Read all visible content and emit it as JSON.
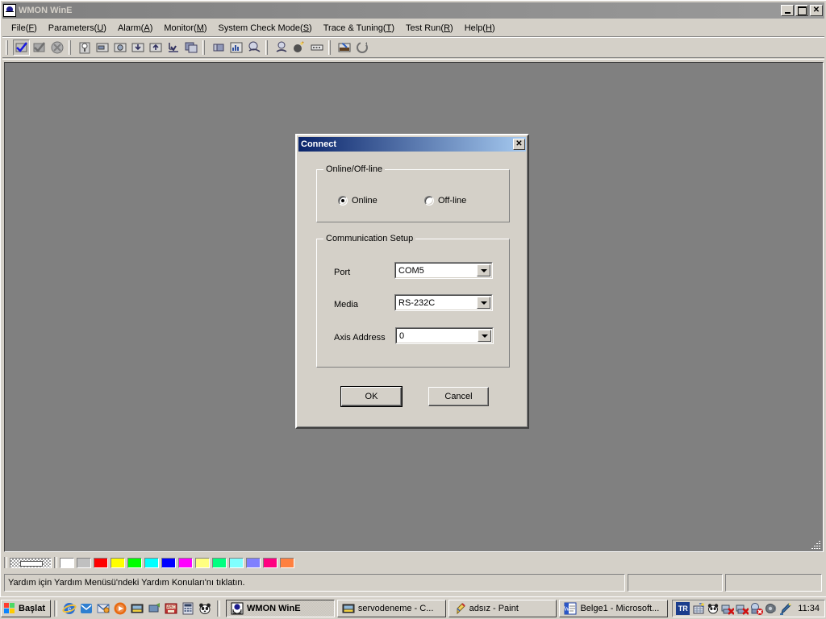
{
  "window": {
    "title": "WMON WinE",
    "icon": "app-icon",
    "controls": {
      "minimize": "_",
      "maximize": "□",
      "close": "✕"
    }
  },
  "menubar": {
    "items": [
      {
        "label": "File(F)",
        "text": "File(",
        "accel": "F",
        "tail": ")"
      },
      {
        "label": "Parameters(U)",
        "text": "Parameters(",
        "accel": "U",
        "tail": ")"
      },
      {
        "label": "Alarm(A)",
        "text": "Alarm(",
        "accel": "A",
        "tail": ")"
      },
      {
        "label": "Monitor(M)",
        "text": "Monitor(",
        "accel": "M",
        "tail": ")"
      },
      {
        "label": "System Check Mode(S)",
        "text": "System Check Mode(",
        "accel": "S",
        "tail": ")"
      },
      {
        "label": "Trace & Tuning(T)",
        "text": "Trace & Tuning(",
        "accel": "T",
        "tail": ")"
      },
      {
        "label": "Test Run(R)",
        "text": "Test Run(",
        "accel": "R",
        "tail": ")"
      },
      {
        "label": "Help(H)",
        "text": "Help(",
        "accel": "H",
        "tail": ")"
      }
    ]
  },
  "toolbar": {
    "buttons": [
      {
        "name": "connect-check-icon",
        "state": "pressed"
      },
      {
        "name": "disconnect-icon",
        "state": "normal"
      },
      {
        "name": "stop-icon",
        "state": "normal"
      },
      {
        "name": "alarm-icon",
        "state": "normal"
      },
      {
        "name": "parameter-list-icon",
        "state": "normal"
      },
      {
        "name": "parameter-edit-icon",
        "state": "normal"
      },
      {
        "name": "download-icon",
        "state": "normal"
      },
      {
        "name": "upload-icon",
        "state": "normal"
      },
      {
        "name": "save-to-device-icon",
        "state": "normal"
      },
      {
        "name": "compare-icon",
        "state": "normal"
      },
      {
        "name": "device-copy-icon",
        "state": "normal"
      },
      {
        "name": "monitor-chart-icon",
        "state": "normal"
      },
      {
        "name": "scope-icon",
        "state": "normal"
      },
      {
        "name": "trace-icon",
        "state": "normal"
      },
      {
        "name": "tuning-icon",
        "state": "normal"
      },
      {
        "name": "jog-icon",
        "state": "normal"
      },
      {
        "name": "test-run-icon",
        "state": "normal"
      },
      {
        "name": "help-icon",
        "state": "normal"
      }
    ]
  },
  "dialog": {
    "title": "Connect",
    "close_label": "✕",
    "groups": {
      "mode": {
        "legend": "Online/Off-line",
        "options": [
          {
            "label": "Online",
            "selected": true
          },
          {
            "label": "Off-line",
            "selected": false
          }
        ]
      },
      "comm": {
        "legend": "Communication Setup",
        "fields": [
          {
            "label": "Port",
            "value": "COM5"
          },
          {
            "label": "Media",
            "value": "RS-232C"
          },
          {
            "label": "Axis Address",
            "value": "0"
          }
        ]
      }
    },
    "buttons": {
      "ok": "OK",
      "cancel": "Cancel"
    }
  },
  "palette": {
    "colors": [
      "#ffffff",
      "#c0c0c0",
      "#ff0000",
      "#ffff00",
      "#00ff00",
      "#00ffff",
      "#0000ff",
      "#ff00ff",
      "#ffff80",
      "#00ff80",
      "#80ffff",
      "#8080ff",
      "#ff0080",
      "#ff8040"
    ]
  },
  "statusbar": {
    "message": "Yardım için Yardım Menüsü'ndeki Yardım Konuları'nı tıklatın.",
    "panel2": "",
    "panel3": ""
  },
  "taskbar": {
    "start": "Başlat",
    "quicklaunch": [
      {
        "name": "internet-explorer-icon"
      },
      {
        "name": "outlook-express-icon"
      },
      {
        "name": "mail-icon"
      },
      {
        "name": "media-player-icon"
      },
      {
        "name": "servo-app-icon"
      },
      {
        "name": "desktop-tv-icon"
      },
      {
        "name": "abc-dictionary-icon"
      },
      {
        "name": "calculator-icon"
      },
      {
        "name": "panda-antivirus-icon"
      }
    ],
    "tasks": [
      {
        "label": "WMON WinE",
        "icon": "app-icon",
        "active": true
      },
      {
        "label": "servodeneme - C...",
        "icon": "servo-doc-icon",
        "active": false
      },
      {
        "label": "adsız - Paint",
        "icon": "paint-icon",
        "active": false
      },
      {
        "label": "Belge1 - Microsoft...",
        "icon": "word-icon",
        "active": false
      }
    ],
    "tray": {
      "language": "TR",
      "icons": [
        {
          "name": "network-config-icon"
        },
        {
          "name": "panda-shield-icon"
        },
        {
          "name": "network-disconnected-icon"
        },
        {
          "name": "network-disconnected-2-icon"
        },
        {
          "name": "safely-remove-error-icon"
        },
        {
          "name": "volume-icon"
        },
        {
          "name": "pen-tablet-icon"
        }
      ],
      "clock": "11:34"
    }
  },
  "colors": {
    "face": "#d4d0c8",
    "desktop": "#808080",
    "title_active_start": "#0a246a",
    "title_active_end": "#a6caf0",
    "title_inactive_start": "#808080",
    "title_inactive_end": "#9a9a9a"
  }
}
